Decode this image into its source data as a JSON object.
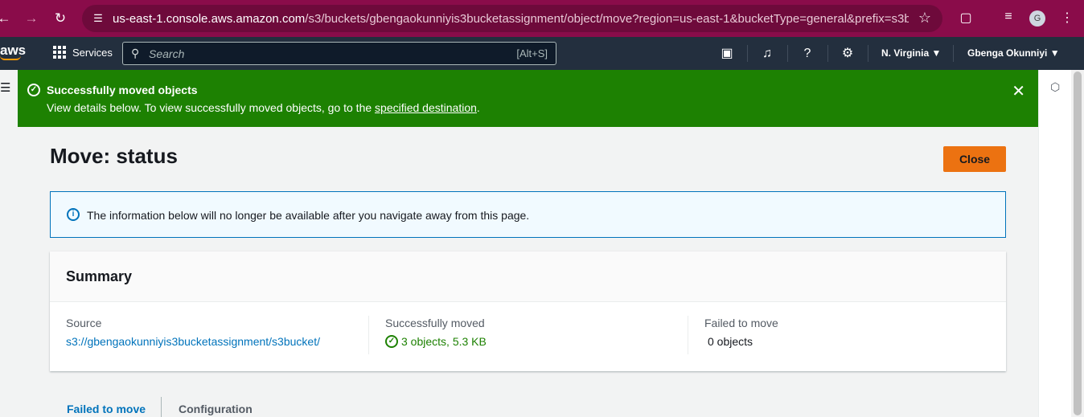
{
  "browser": {
    "url_host": "us-east-1.console.aws.amazon.com",
    "url_path": "/s3/buckets/gbengaokunniyis3bucketassignment/object/move?region=us-east-1&bucketType=general&prefix=s3bucket/&...",
    "profile_initial": "G"
  },
  "aws_nav": {
    "logo": "aws",
    "services_label": "Services",
    "search_placeholder": "Search",
    "search_shortcut": "[Alt+S]",
    "region": "N. Virginia",
    "account": "Gbenga Okunniyi"
  },
  "flash": {
    "title": "Successfully moved objects",
    "message_prefix": "View details below. To view successfully moved objects, go to the ",
    "link_text": "specified destination",
    "message_suffix": "."
  },
  "page": {
    "title": "Move: status",
    "close_label": "Close"
  },
  "info": {
    "text": "The information below will no longer be available after you navigate away from this page."
  },
  "summary": {
    "heading": "Summary",
    "source_label": "Source",
    "source_value": "s3://gbengaokunniyis3bucketassignment/s3bucket/",
    "moved_label": "Successfully moved",
    "moved_value": "3 objects, 5.3 KB",
    "failed_label": "Failed to move",
    "failed_value": "0 objects"
  },
  "tabs": [
    {
      "label": "Failed to move"
    },
    {
      "label": "Configuration"
    }
  ],
  "colors": {
    "browser_bar": "#8a0c4a",
    "aws_nav": "#232f3e",
    "success": "#1d8102",
    "link": "#0073bb",
    "primary_button": "#ec7211"
  }
}
